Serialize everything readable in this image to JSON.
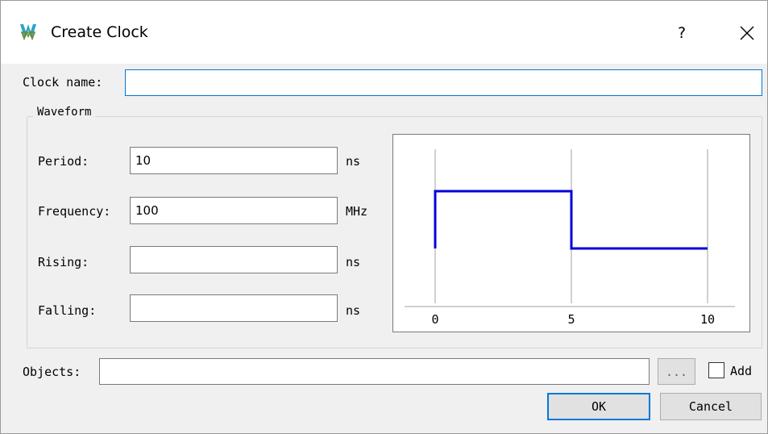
{
  "window": {
    "title": "Create Clock",
    "help_label": "?",
    "app_icon": "gowin-logo-icon",
    "help_icon": "question-icon",
    "close_icon": "close-icon"
  },
  "clock_name": {
    "label": "Clock name:",
    "value": ""
  },
  "waveform": {
    "group_label": "Waveform",
    "period": {
      "label": "Period:",
      "value": "10",
      "unit": "ns"
    },
    "frequency": {
      "label": "Frequency:",
      "value": "100",
      "unit": "MHz"
    },
    "rising": {
      "label": "Rising:",
      "value": "",
      "unit": "ns"
    },
    "falling": {
      "label": "Falling:",
      "value": "",
      "unit": "ns"
    },
    "preview": {
      "tick_labels": [
        "0",
        "5",
        "10"
      ],
      "high_from": 0,
      "high_to": 5,
      "end": 10,
      "line_color": "#0000dd",
      "grid_color": "#d0d0d0"
    }
  },
  "objects": {
    "label": "Objects:",
    "value": "",
    "browse_label": "...",
    "add_label": "Add",
    "add_checked": false
  },
  "buttons": {
    "ok": "OK",
    "cancel": "Cancel"
  },
  "colors": {
    "focus_border": "#0078d7",
    "dialog_bg": "#f0f0f0"
  }
}
